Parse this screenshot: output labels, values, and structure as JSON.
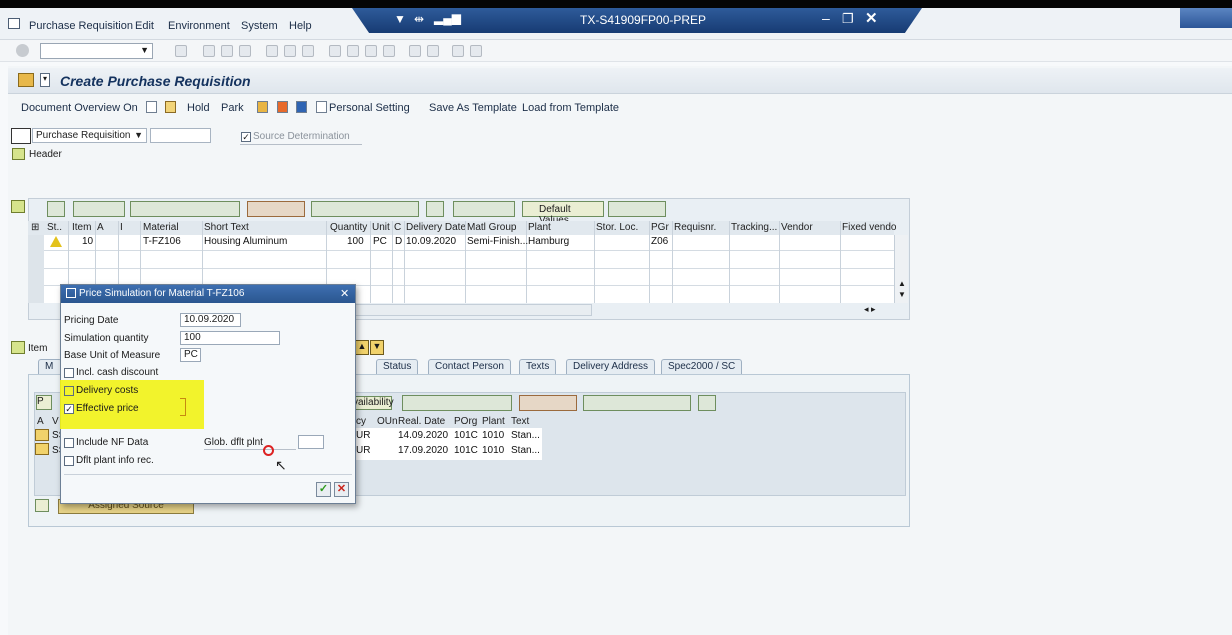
{
  "window": {
    "title": "TX-S41909FP00-PREP"
  },
  "menu": [
    "Purchase Requisition",
    "Edit",
    "Environment",
    "System",
    "Help"
  ],
  "page": {
    "title": "Create Purchase Requisition"
  },
  "app_toolbar": {
    "doc_overview": "Document Overview On",
    "hold": "Hold",
    "park": "Park",
    "personal_setting": "Personal Setting",
    "save_as_template": "Save As Template",
    "load_from_template": "Load from Template"
  },
  "doc_type": {
    "value": "Purchase Requisition",
    "source_determination": "Source Determination",
    "header": "Header"
  },
  "grid": {
    "default_values": "Default Values",
    "columns": [
      "St..",
      "Item",
      "A",
      "I",
      "Material",
      "Short Text",
      "Quantity",
      "Unit",
      "C",
      "Delivery Date",
      "Matl Group",
      "Plant",
      "Stor. Loc.",
      "PGr",
      "Requisnr.",
      "Tracking...",
      "Vendor",
      "Fixed vendo"
    ],
    "row": {
      "item": "10",
      "material": "T-FZ106",
      "short_text": "Housing Aluminum",
      "quantity": "100",
      "unit": "PC",
      "c": "D",
      "delivery_date": "10.09.2020",
      "matl_group": "Semi-Finish...",
      "plant": "Hamburg",
      "pgr": "Z06"
    }
  },
  "item_section": {
    "label": "Item",
    "tabs": [
      "M",
      "Status",
      "Contact Person",
      "Texts",
      "Delivery Address",
      "Spec2000 / SC"
    ],
    "availability": "vailability",
    "sub_columns": [
      "A",
      "V",
      "cy",
      "OUn",
      "Real. Date",
      "POrg",
      "Plant",
      "Text"
    ],
    "sub_rows": [
      {
        "v": "SS",
        "cy": "UR",
        "date": "14.09.2020",
        "porg": "101C",
        "plant": "1010",
        "text": "Stan..."
      },
      {
        "v": "SS",
        "cy": "UR",
        "date": "17.09.2020",
        "porg": "101C",
        "plant": "1010",
        "text": "Stan..."
      }
    ],
    "assigned_source": "Assigned Source"
  },
  "dialog": {
    "title": "Price Simulation for Material T-FZ106",
    "pricing_date_label": "Pricing Date",
    "pricing_date": "10.09.2020",
    "sim_qty_label": "Simulation quantity",
    "sim_qty": "100",
    "base_uom_label": "Base Unit of Measure",
    "base_uom": "PC",
    "incl_cash": "Incl. cash discount",
    "delivery_costs": "Delivery costs",
    "effective_price": "Effective price",
    "include_nf": "Include NF Data",
    "glob_dflt": "Glob. dflt plnt",
    "dflt_plant_info": "Dflt plant info rec."
  }
}
